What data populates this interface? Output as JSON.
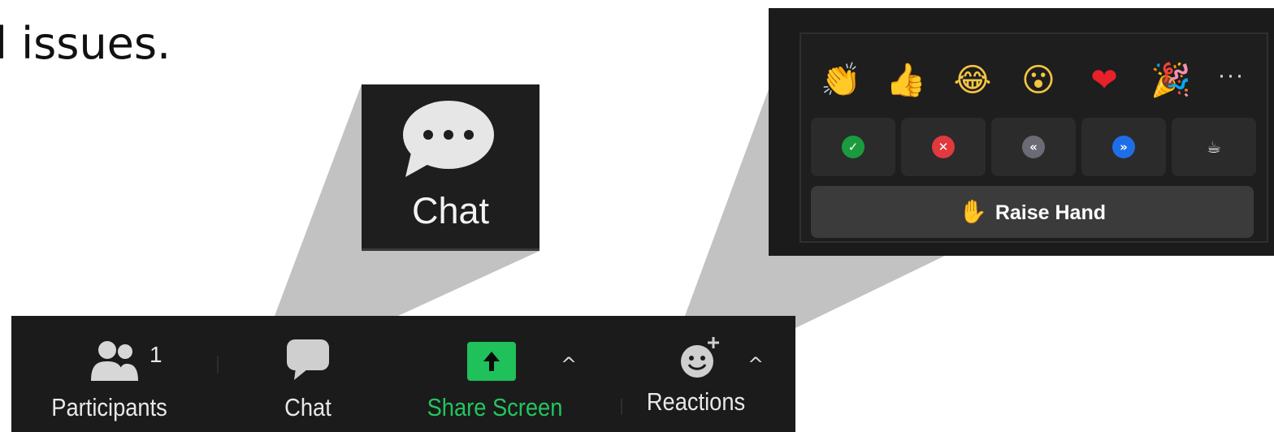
{
  "intro_text": "l issues.",
  "chat_zoom": {
    "icon": "chat-bubble-icon",
    "label": "Chat"
  },
  "reactions_panel": {
    "emojis": [
      {
        "name": "clapping-hands",
        "glyph": "👏"
      },
      {
        "name": "thumbs-up",
        "glyph": "👍"
      },
      {
        "name": "tears-of-joy",
        "glyph": "😂"
      },
      {
        "name": "open-mouth",
        "glyph": "😮"
      },
      {
        "name": "red-heart",
        "glyph": "❤"
      },
      {
        "name": "party-popper",
        "glyph": "🎉"
      }
    ],
    "more_label": "···",
    "status_buttons": [
      {
        "name": "yes",
        "glyph": "✓",
        "color": "#1a9c3e"
      },
      {
        "name": "no",
        "glyph": "✕",
        "color": "#e0393e"
      },
      {
        "name": "slow-down",
        "glyph": "«",
        "color": "#6b6b76"
      },
      {
        "name": "speed-up",
        "glyph": "»",
        "color": "#1e6ee8"
      },
      {
        "name": "coffee",
        "glyph": "☕",
        "color": "#2b2b2b"
      }
    ],
    "raise_hand": {
      "glyph": "✋",
      "label": "Raise Hand"
    }
  },
  "toolbar": {
    "participants": {
      "label": "Participants",
      "count": "1"
    },
    "chat": {
      "label": "Chat"
    },
    "share_screen": {
      "label": "Share Screen",
      "chevron": "^"
    },
    "reactions": {
      "label": "Reactions",
      "chevron": "^"
    }
  },
  "colors": {
    "toolbar_bg": "#1b1b1b",
    "share_green": "#20c05a",
    "callout_gray": "#c2c2c2"
  }
}
